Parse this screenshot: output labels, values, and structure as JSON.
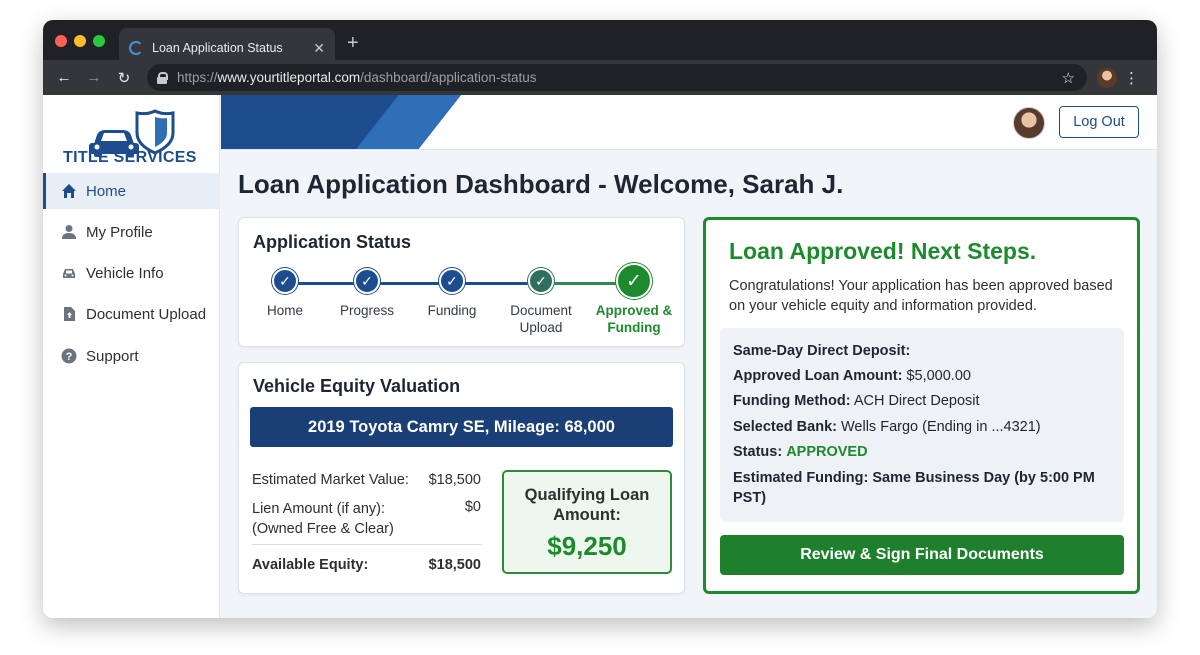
{
  "browser": {
    "tab_title": "Loan Application Status",
    "url_scheme": "https://",
    "url_host": "www.yourtitleportal.com",
    "url_path": "/dashboard/application-status"
  },
  "brand": {
    "name": "TITLE SERVICES",
    "primary_color": "#1d4d8f",
    "success_color": "#1e8a2e"
  },
  "sidebar": {
    "items": [
      {
        "label": "Home",
        "icon": "home-icon",
        "active": true
      },
      {
        "label": "My Profile",
        "icon": "user-icon",
        "active": false
      },
      {
        "label": "Vehicle Info",
        "icon": "car-icon",
        "active": false
      },
      {
        "label": "Document Upload",
        "icon": "document-icon",
        "active": false
      },
      {
        "label": "Support",
        "icon": "help-icon",
        "active": false
      }
    ]
  },
  "header": {
    "logout_label": "Log Out"
  },
  "page": {
    "title": "Loan Application Dashboard - Welcome, Sarah J."
  },
  "status_card": {
    "title": "Application Status",
    "steps": [
      {
        "label": "Home",
        "state": "complete"
      },
      {
        "label": "Progress",
        "state": "complete"
      },
      {
        "label": "Funding",
        "state": "complete"
      },
      {
        "label_line1": "Document",
        "label_line2": "Upload",
        "state": "complete"
      },
      {
        "label_line1": "Approved &",
        "label_line2": "Funding",
        "state": "current"
      }
    ]
  },
  "equity_card": {
    "title": "Vehicle Equity Valuation",
    "vehicle": "2019 Toyota Camry SE, Mileage: 68,000",
    "market_value_label": "Estimated Market Value:",
    "market_value": "$18,500",
    "lien_label_line1": "Lien Amount (if any):",
    "lien_label_line2": "(Owned Free & Clear)",
    "lien_value": "$0",
    "equity_label": "Available Equity:",
    "equity_value": "$18,500",
    "qualifying_label_line1": "Qualifying Loan",
    "qualifying_label_line2": "Amount:",
    "qualifying_amount": "$9,250"
  },
  "approved_card": {
    "title": "Loan Approved! Next Steps.",
    "message": "Congratulations! Your application has been approved based on your vehicle equity and information provided.",
    "deposit_heading": "Same-Day Direct Deposit:",
    "amount_label": "Approved Loan Amount:",
    "amount_value": "$5,000.00",
    "method_label": "Funding Method:",
    "method_value": "ACH Direct Deposit",
    "bank_label": "Selected Bank:",
    "bank_value": "Wells Fargo (Ending in ...4321)",
    "status_label": "Status:",
    "status_value": "APPROVED",
    "funding_label": "Estimated Funding:",
    "funding_value_line1": "Same Business Day (by 5:00 PM",
    "funding_value_line2": "PST)",
    "button_label": "Review & Sign Final Documents"
  }
}
